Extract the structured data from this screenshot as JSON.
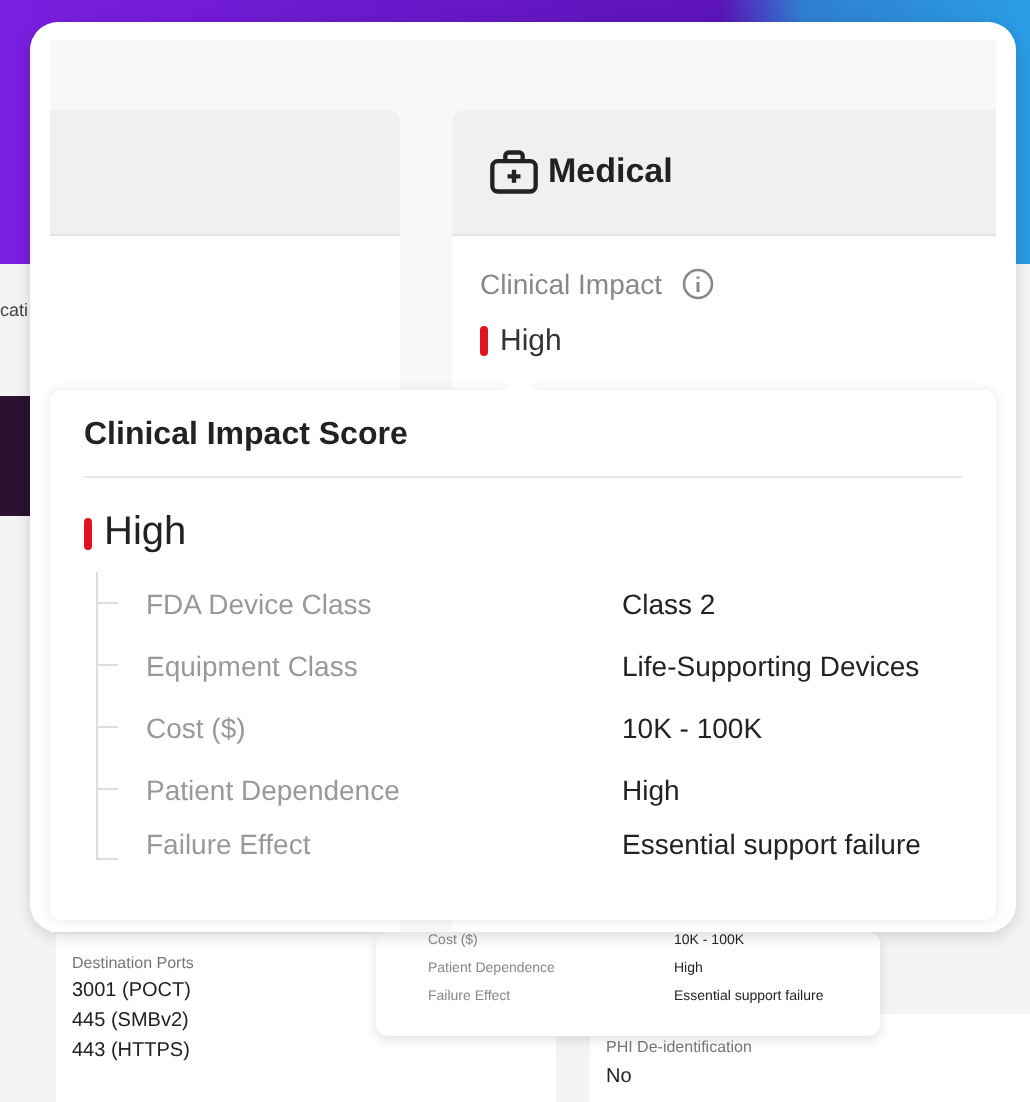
{
  "background": {
    "side_text": "cati",
    "ports_label": "Destination Ports",
    "ports": [
      "3001 (POCT)",
      "445 (SMBv2)",
      "443 (HTTPS)"
    ],
    "mini_tooltip_rows": [
      {
        "label": "Cost ($)",
        "value": "10K - 100K"
      },
      {
        "label": "Patient Dependence",
        "value": "High"
      },
      {
        "label": "Failure Effect",
        "value": "Essential support failure"
      }
    ],
    "phi_label": "PHI De-identification",
    "phi_value": "No"
  },
  "medical_panel": {
    "title": "Medical",
    "field_label": "Clinical Impact",
    "value": "High",
    "color": "#e0141e"
  },
  "tooltip": {
    "title": "Clinical Impact Score",
    "value": "High",
    "color": "#e0141e",
    "rows": [
      {
        "label": "FDA Device Class",
        "value": "Class 2"
      },
      {
        "label": "Equipment Class",
        "value": "Life-Supporting Devices"
      },
      {
        "label": "Cost ($)",
        "value": "10K - 100K"
      },
      {
        "label": "Patient Dependence",
        "value": "High"
      },
      {
        "label": "Failure Effect",
        "value": "Essential support failure"
      }
    ]
  }
}
